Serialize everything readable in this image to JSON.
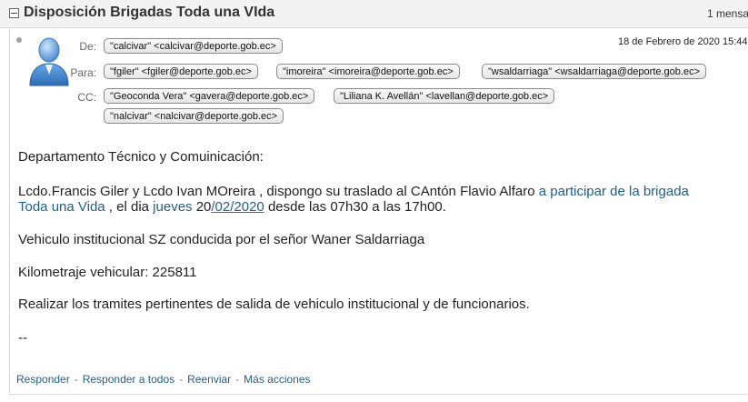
{
  "thread": {
    "title": "Disposición Brigadas Toda una VIda",
    "count": "1 mensa"
  },
  "message": {
    "date": "18 de Febrero de 2020 15:44",
    "labels": {
      "from": "De:",
      "to": "Para:",
      "cc": "CC:"
    },
    "from": [
      "\"calcivar\" <calcivar@deporte.gob.ec>"
    ],
    "to": [
      "\"fgiler\" <fgiler@deporte.gob.ec>",
      "\"imoreira\" <imoreira@deporte.gob.ec>",
      "\"wsaldarriaga\" <wsaldarriaga@deporte.gob.ec>"
    ],
    "cc": [
      "\"Geoconda Vera\" <gavera@deporte.gob.ec>",
      "\"Liliana K. Avellán\" <lavellan@deporte.gob.ec>",
      "\"nalcivar\" <nalcivar@deporte.gob.ec>"
    ]
  },
  "body": {
    "line1": "Departamento Técnico y Comuinicación:",
    "line2_part1": "Lcdo.Francis Giler y Lcdo Ivan MOreira , dispongo su traslado al CAntón Flavio Alfaro ",
    "line2_link": "a participar de la brigada",
    "line3_link": "Toda una Vida",
    "line3_part1": " , el dia ",
    "line3_weekday": "jueves",
    "line3_day": " 20",
    "line3_date_link": "/02/2020",
    "line3_part2": " desde las 07h30 a las 17h00.",
    "line4": "Vehiculo institucional SZ conducida por el señor Waner Saldarriaga",
    "line5": "Kilometraje vehicular: 225811",
    "line6": "Realizar los tramites pertinentes de salida  de vehiculo institucional y de funcionarios.",
    "line7": "--"
  },
  "footer": {
    "reply": "Responder",
    "reply_all": "Responder a todos",
    "forward": "Reenviar",
    "more": "Más acciones",
    "separator": "-"
  }
}
